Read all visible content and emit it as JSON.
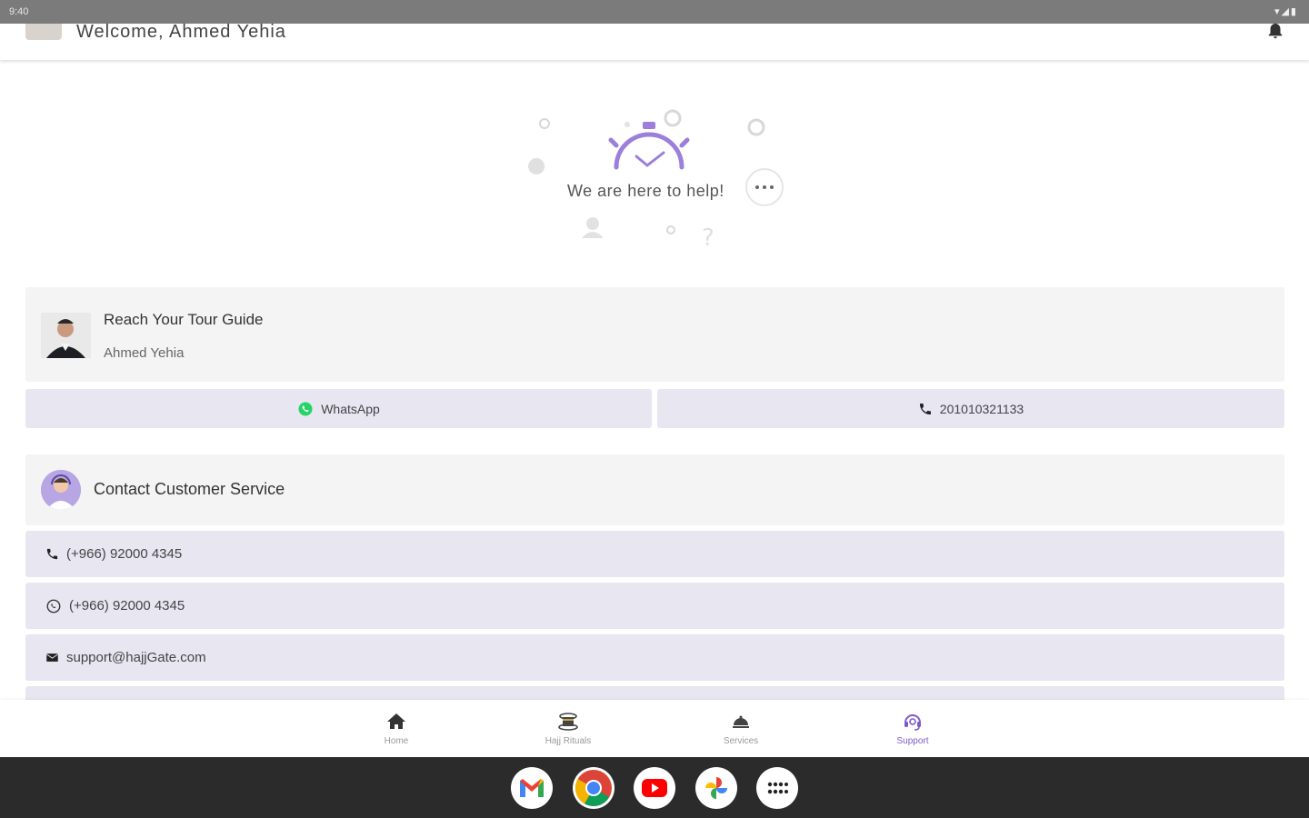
{
  "status_bar": {
    "time": "9:40",
    "sys_icons": "▾◢▮"
  },
  "header": {
    "welcome": "Welcome, Ahmed Yehia"
  },
  "hero": {
    "text": "We are here to help!"
  },
  "guide": {
    "title": "Reach Your Tour Guide",
    "name": "Ahmed Yehia",
    "whatsapp_label": "WhatsApp",
    "phone_label": "201010321133"
  },
  "customer_service": {
    "title": "Contact Customer Service",
    "contacts": [
      {
        "icon": "phone-icon",
        "label": "(+966) 92000 4345"
      },
      {
        "icon": "whatsapp-icon",
        "label": "(+966) 92000 4345"
      },
      {
        "icon": "mail-icon",
        "label": "support@hajjGate.com"
      }
    ]
  },
  "bottom_nav": [
    {
      "label": "Home",
      "icon": "home-icon",
      "active": false
    },
    {
      "label": "Hajj Rituals",
      "icon": "kaaba-icon",
      "active": false
    },
    {
      "label": "Services",
      "icon": "services-icon",
      "active": false
    },
    {
      "label": "Support",
      "icon": "headset-icon",
      "active": true
    }
  ],
  "colors": {
    "accent": "#7c5ccc",
    "card_bg": "#f4f4f5",
    "button_bg": "#e7e6f1",
    "whatsapp": "#25d366"
  },
  "taskbar_apps": [
    "gmail-icon",
    "chrome-icon",
    "youtube-icon",
    "photos-icon",
    "app-launcher-icon"
  ]
}
